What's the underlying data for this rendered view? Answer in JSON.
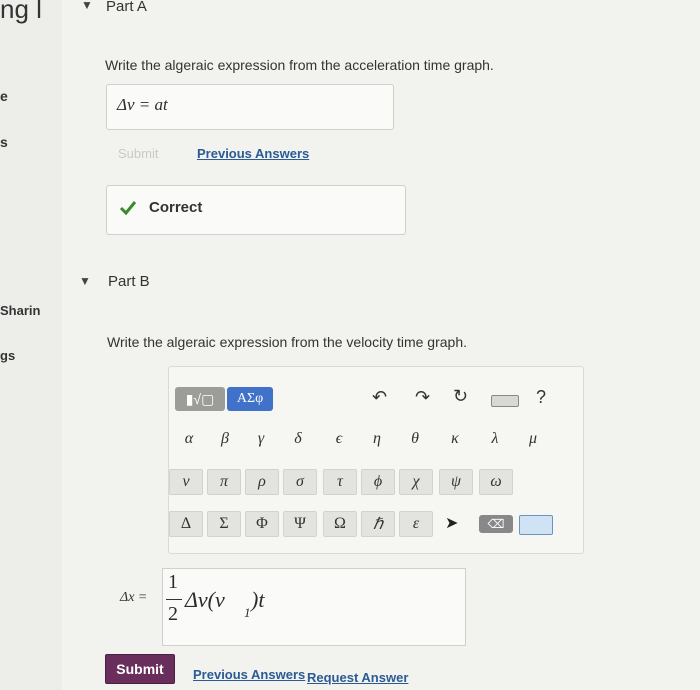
{
  "sidebar": {
    "frag1": "ng l",
    "frag2": "e",
    "frag3": "s",
    "frag4": "Sharin",
    "frag5": "gs"
  },
  "partA": {
    "title": "Part A",
    "prompt": "Write the algeraic expression from the acceleration time graph.",
    "answer": "Δv = at",
    "submit_label": "Submit",
    "previous_answers_label": "Previous Answers",
    "feedback": "Correct"
  },
  "partB": {
    "title": "Part B",
    "prompt": "Write the algeraic expression from the velocity time graph.",
    "toolbar": {
      "template_label": "▮√▢",
      "greek_label": "ΑΣφ",
      "help_label": "?"
    },
    "keys_row1": [
      "α",
      "β",
      "γ",
      "δ",
      "ϵ",
      "η",
      "θ",
      "κ",
      "λ",
      "μ"
    ],
    "keys_row2": [
      "ν",
      "π",
      "ρ",
      "σ",
      "τ",
      "ϕ",
      "χ",
      "ψ",
      "ω"
    ],
    "keys_row3": [
      "Δ",
      "Σ",
      "Φ",
      "Ψ",
      "Ω",
      "ℏ",
      "ε"
    ],
    "expr_lhs": "Δx =",
    "frac_num": "1",
    "frac_den": "2",
    "expr_rest": "Δv(v",
    "expr_sub": "1",
    "expr_tail": ")t",
    "submit_label": "Submit",
    "previous_answers_label": "Previous Answers",
    "request_answer_label": "Request Answer"
  }
}
